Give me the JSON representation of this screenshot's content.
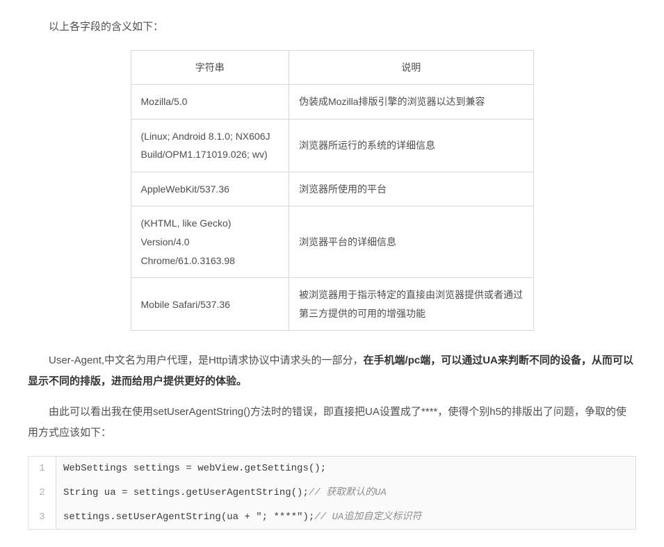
{
  "intro": "以上各字段的含义如下：",
  "table": {
    "headers": [
      "字符串",
      "说明"
    ],
    "rows": [
      {
        "str": "Mozilla/5.0",
        "desc": "伪装成Mozilla排版引擎的浏览器以达到兼容"
      },
      {
        "str": "(Linux; Android 8.1.0; NX606J Build/OPM1.171019.026; wv)",
        "desc": "浏览器所运行的系统的详细信息"
      },
      {
        "str": "AppleWebKit/537.36",
        "desc": "浏览器所使用的平台"
      },
      {
        "str": "(KHTML, like Gecko) Version/4.0 Chrome/61.0.3163.98",
        "desc": "浏览器平台的详细信息"
      },
      {
        "str": "Mobile Safari/537.36",
        "desc": "被浏览器用于指示特定的直接由浏览器提供或者通过第三方提供的可用的增强功能"
      }
    ]
  },
  "para1_a": "User-Agent,中文名为用户代理，是Http请求协议中请求头的一部分，",
  "para1_b": "在手机端/pc端，可以通过UA来判断不同的设备，从而可以显示不同的排版，进而给用户提供更好的体验。",
  "para2": "由此可以看出我在使用setUserAgentString()方法时的错误，即直接把UA设置成了****，使得个别h5的排版出了问题，争取的使用方式应该如下：",
  "code": {
    "lines": [
      {
        "n": "1",
        "text": "WebSettings settings = webView.getSettings();",
        "comment": ""
      },
      {
        "n": "2",
        "text": "String ua = settings.getUserAgentString();",
        "comment": "// 获取默认的UA"
      },
      {
        "n": "3",
        "text": "settings.setUserAgentString(ua + \"; ****\");",
        "comment": "// UA追加自定义标识符"
      }
    ]
  }
}
